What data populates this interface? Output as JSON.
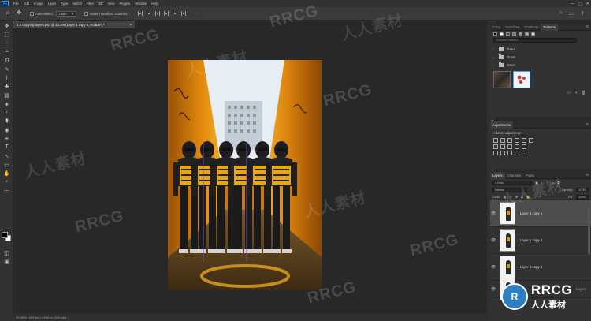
{
  "menubar": {
    "app_icon": "Ps",
    "items": [
      "File",
      "Edit",
      "Image",
      "Layer",
      "Type",
      "Select",
      "Filter",
      "3D",
      "View",
      "Plugins",
      "Window",
      "Help"
    ],
    "win_controls": [
      "—",
      "▢",
      "✕"
    ]
  },
  "options_bar": {
    "tool_icon": "move-tool-icon",
    "auto_select_label": "Auto-Select:",
    "auto_select_value": "Layer",
    "show_transform_label": "Show Transform Controls",
    "more_label": "···"
  },
  "document": {
    "tab_title": "2.4 Copying layers.psd @ 33.3% (Layer 1 copy 5, RGB/8*) *",
    "close_label": "×",
    "status": "33.33%   1289 px x 2250 px (240 ppi)   ›"
  },
  "toolbar": {
    "tools": [
      "✥",
      "⬚",
      "◌",
      "⌗",
      "⊡",
      "✎",
      "⌇",
      "✚",
      "▤",
      "◈",
      "◐",
      "⬮",
      "◉",
      "✒",
      "T",
      "↖",
      "▭",
      "✋",
      "⌕",
      "⋯"
    ]
  },
  "swatches_panel": {
    "tabs": [
      "Color",
      "Swatches",
      "Gradients",
      "Patterns"
    ],
    "active_tab": "Patterns",
    "search_placeholder": "Search Patterns",
    "groups": [
      "Trees",
      "Grass",
      "Water"
    ]
  },
  "adjustments_panel": {
    "tabs": [
      "Adjustments"
    ],
    "add_label": "Add an adjustment"
  },
  "layers_panel": {
    "tabs": [
      "Layers",
      "Channels",
      "Paths"
    ],
    "active_tab": "Layers",
    "filter_kind": "Kind",
    "blend_mode": "Normal",
    "opacity_label": "Opacity:",
    "opacity_value": "100%",
    "lock_label": "Lock:",
    "fill_label": "Fill:",
    "fill_value": "100%",
    "layers": [
      {
        "name": "Layer 1 copy 5",
        "selected": true
      },
      {
        "name": "Layer 1 copy 4",
        "selected": false
      },
      {
        "name": "Layer 1 copy 3",
        "selected": false
      }
    ],
    "partial_label": "Layers"
  },
  "watermarks": {
    "en": "RRCG",
    "cn": "人人素材",
    "brand_en": "RRCG",
    "brand_cn": "人人素材"
  },
  "colors": {
    "accent": "#31a8ff",
    "panel_bg": "#323232",
    "canvas_bg": "#282828",
    "selected_layer": "#4d4d4d"
  }
}
